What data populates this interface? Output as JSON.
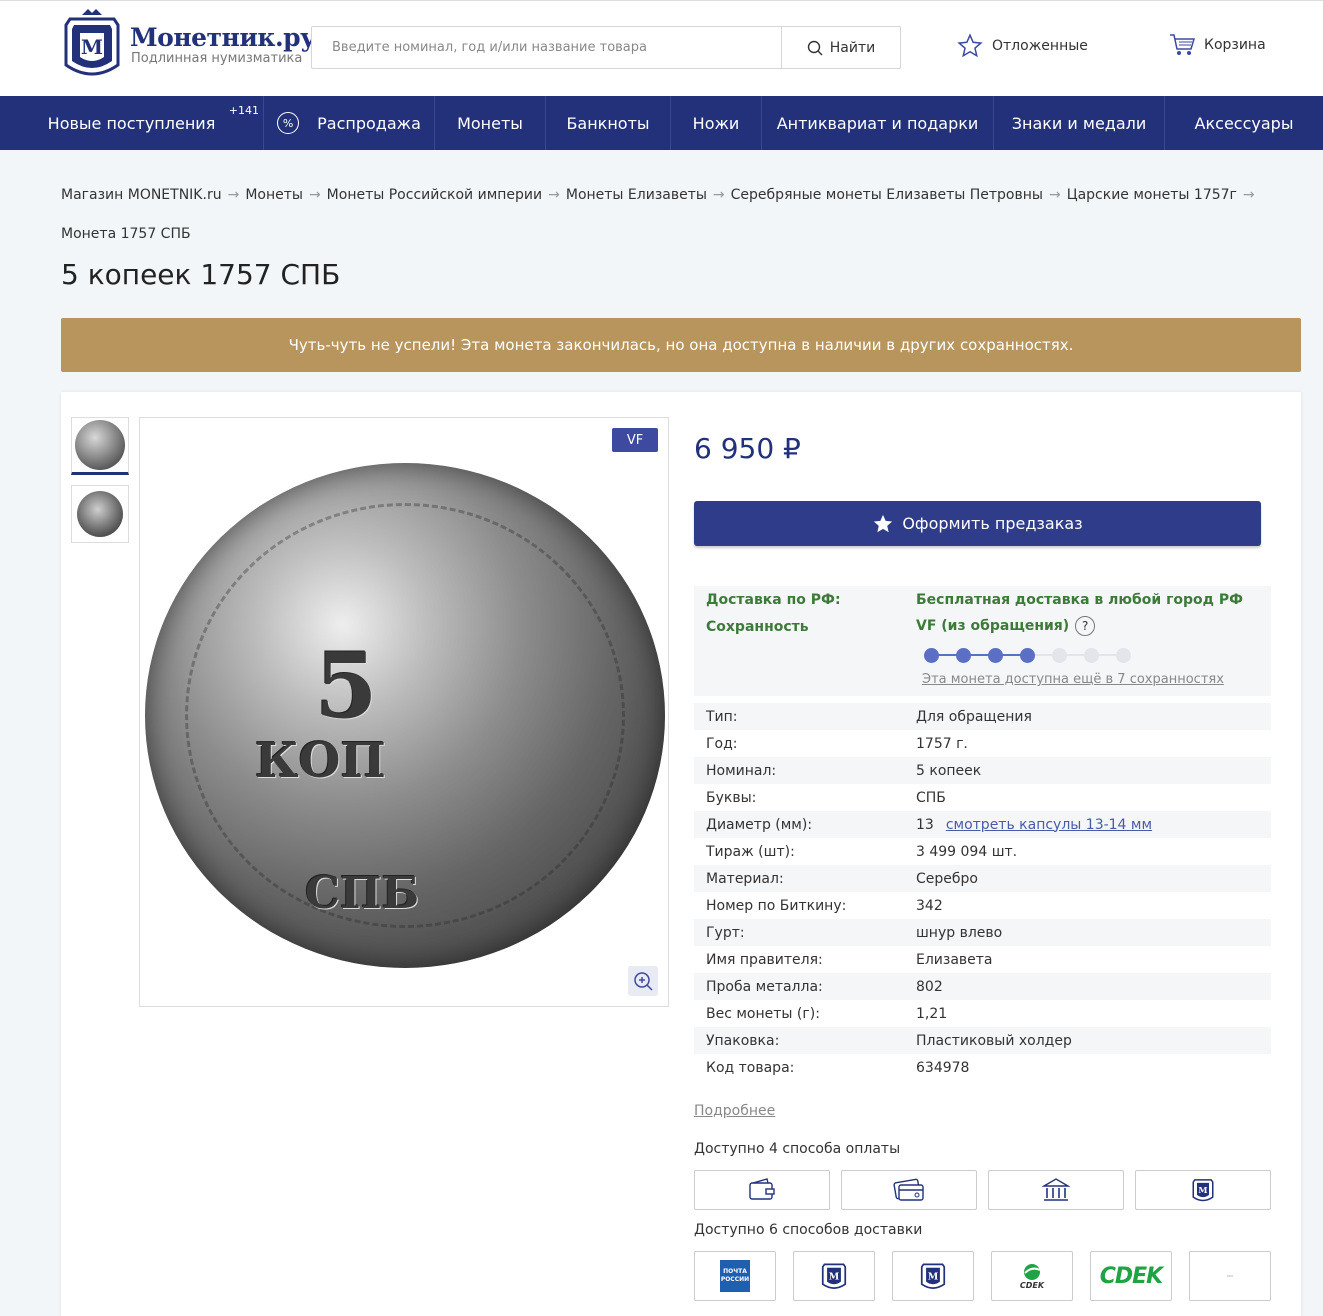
{
  "header": {
    "logo_name": "Монетник.ру",
    "logo_sub": "Подлинная нумизматика",
    "search_placeholder": "Введите номинал, год и/или название товара",
    "search_button": "Найти",
    "favorites": "Отложенные",
    "cart": "Корзина"
  },
  "nav": {
    "items": [
      {
        "label": "Новые поступления",
        "badge": "+141"
      },
      {
        "label": "Распродажа"
      },
      {
        "label": "Монеты"
      },
      {
        "label": "Банкноты"
      },
      {
        "label": "Ножи"
      },
      {
        "label": "Антиквариат и подарки"
      },
      {
        "label": "Знаки и медали"
      },
      {
        "label": "Аксессуары"
      }
    ]
  },
  "breadcrumb": [
    "Магазин MONETNIK.ru",
    "Монеты",
    "Монеты Российской империи",
    "Монеты Елизаветы",
    "Серебряные монеты Елизаветы Петровны",
    "Царские монеты 1757г",
    "Монета 1757 СПБ"
  ],
  "product": {
    "title": "5 копеек 1757 СПБ",
    "banner": "Чуть-чуть не успели! Эта монета закончилась, но она доступна в наличии в других сохранностях.",
    "grade_badge": "VF",
    "coin_five": "5",
    "coin_kop": "КОП",
    "coin_spb": "СПБ",
    "price": "6 950 ₽",
    "preorder_button": "Оформить предзаказ",
    "delivery_label": "Доставка по РФ:",
    "delivery_value": "Бесплатная доставка в любой город РФ",
    "condition_label": "Сохранность",
    "condition_value": "VF (из обращения)",
    "condition_help": "?",
    "grade_scale": {
      "total": 7,
      "filled": 4
    },
    "grade_link": "Эта монета доступна ещё в 7 сохранностях",
    "specs": [
      {
        "label": "Тип:",
        "value": "Для обращения"
      },
      {
        "label": "Год:",
        "value": "1757 г."
      },
      {
        "label": "Номинал:",
        "value": "5 копеек"
      },
      {
        "label": "Буквы:",
        "value": "СПБ"
      },
      {
        "label": "Диаметр (мм):",
        "value": "13",
        "link": "смотреть капсулы 13-14 мм"
      },
      {
        "label": "Тираж (шт):",
        "value": "3 499 094 шт."
      },
      {
        "label": "Материал:",
        "value": "Серебро"
      },
      {
        "label": "Номер по Биткину:",
        "value": "342"
      },
      {
        "label": "Гурт:",
        "value": "шнур влево"
      },
      {
        "label": "Имя правителя:",
        "value": "Елизавета"
      },
      {
        "label": "Проба металла:",
        "value": "802"
      },
      {
        "label": "Вес монеты (г):",
        "value": "1,21"
      },
      {
        "label": "Упаковка:",
        "value": "Пластиковый холдер"
      },
      {
        "label": "Код товара:",
        "value": "634978"
      }
    ],
    "more_link": "Подробнее",
    "payment_title": "Доступно 4 способа оплаты",
    "delivery_title": "Доступно 6 способов доставки",
    "pochta_label": "ПОЧТА РОССИИ",
    "cdek_small": "CDEK",
    "cdek_big": "CDEK"
  },
  "colors": {
    "brand": "#23317b",
    "banner": "#b9955e",
    "green": "#3d7a3a",
    "scale_active": "#5b6fc4",
    "scale_inactive": "#e3e5ea"
  }
}
